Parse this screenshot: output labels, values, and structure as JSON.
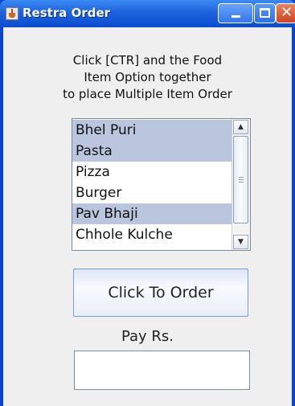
{
  "window": {
    "title": "Restra Order",
    "icons": {
      "app": "java-cup-icon",
      "minimize": "minimize-icon",
      "maximize": "maximize-icon",
      "close": "close-icon"
    },
    "close_glyph": "✕"
  },
  "instructions": {
    "line1": "Click [CTR] and the Food",
    "line2": "Item Option together",
    "line3": "to place Multiple Item Order"
  },
  "food_list": {
    "items": [
      {
        "label": "Bhel Puri",
        "selected": true
      },
      {
        "label": "Pasta",
        "selected": true
      },
      {
        "label": "Pizza",
        "selected": false
      },
      {
        "label": "Burger",
        "selected": false
      },
      {
        "label": "Pav Bhaji",
        "selected": true
      },
      {
        "label": "Chhole Kulche",
        "selected": false
      }
    ]
  },
  "order_button": {
    "label": "Click To Order"
  },
  "payment": {
    "label": "Pay Rs.",
    "value": ""
  },
  "colors": {
    "titlebar": "#1d63dd",
    "selection": "#b9c6de",
    "close": "#cf4322"
  }
}
